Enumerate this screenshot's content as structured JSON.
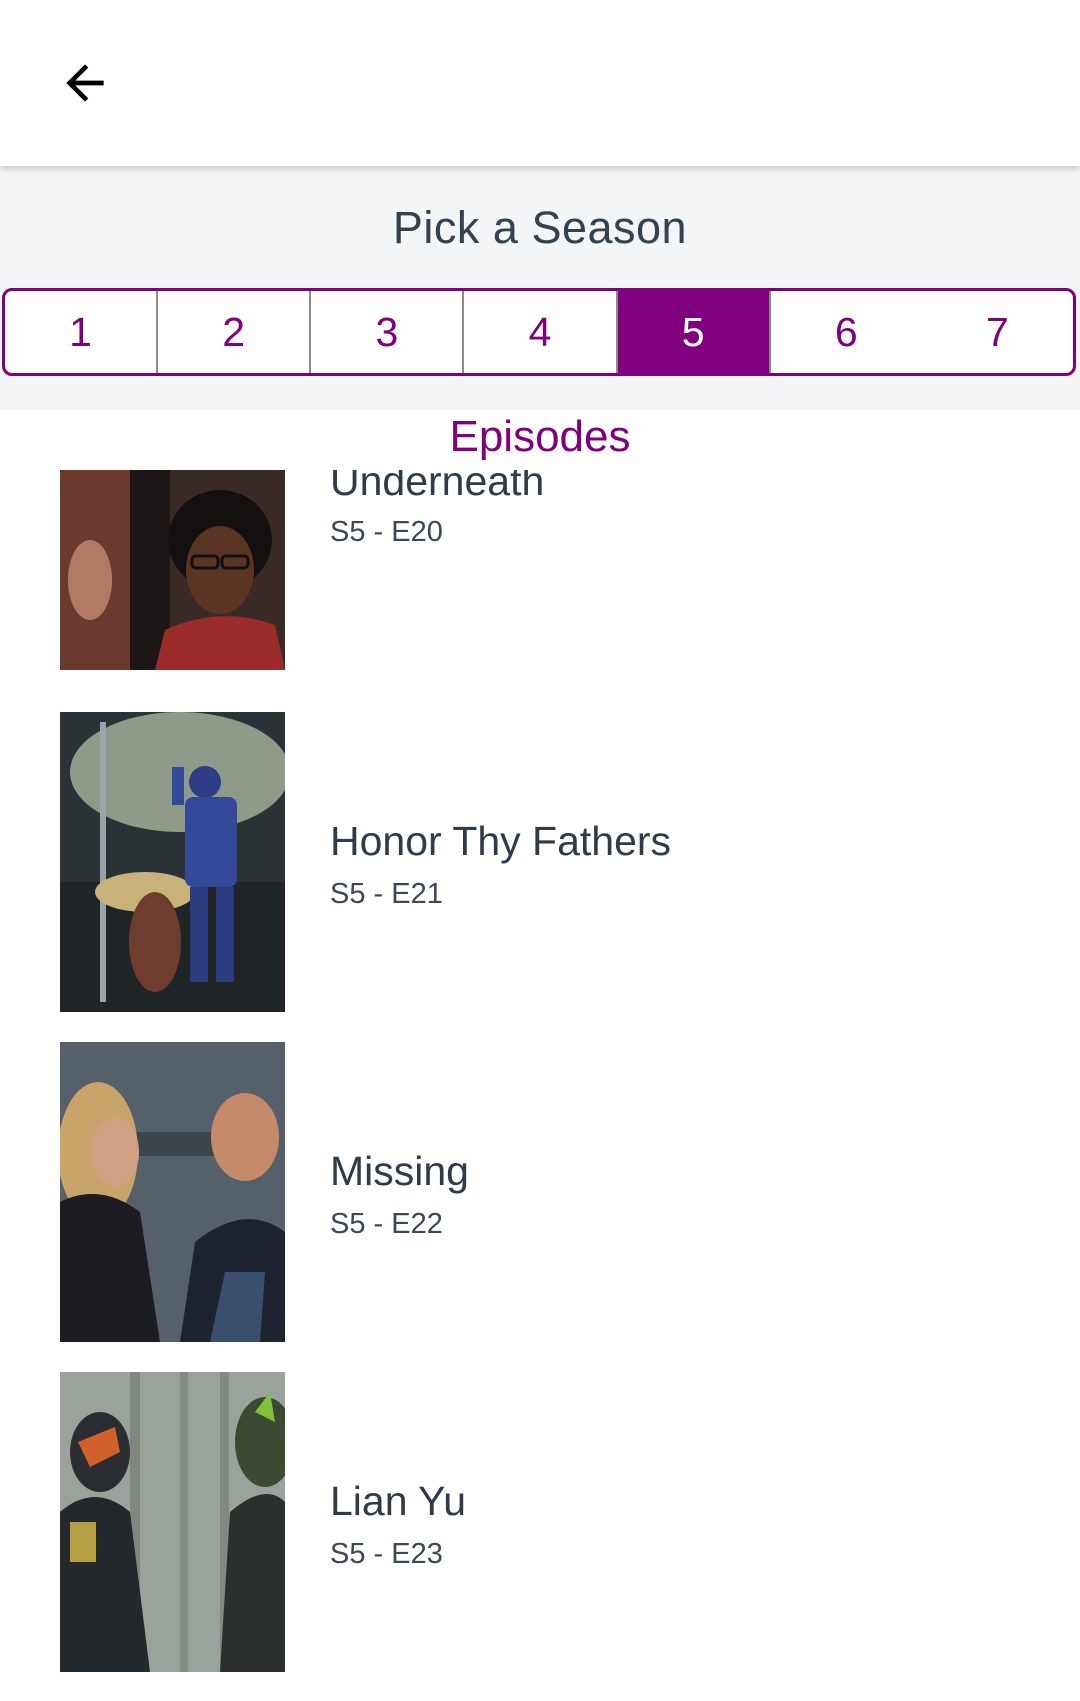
{
  "header": {
    "back_icon": "arrow-left-icon"
  },
  "season_picker": {
    "title": "Pick a Season",
    "seasons": [
      "1",
      "2",
      "3",
      "4",
      "5",
      "6",
      "7"
    ],
    "selected": "5",
    "accent_color": "#800080"
  },
  "episodes": {
    "heading": "Episodes",
    "items": [
      {
        "title": "Underneath",
        "code": "S5 - E20"
      },
      {
        "title": "Honor Thy Fathers",
        "code": "S5 - E21"
      },
      {
        "title": "Missing",
        "code": "S5 - E22"
      },
      {
        "title": "Lian Yu",
        "code": "S5 - E23"
      }
    ]
  }
}
